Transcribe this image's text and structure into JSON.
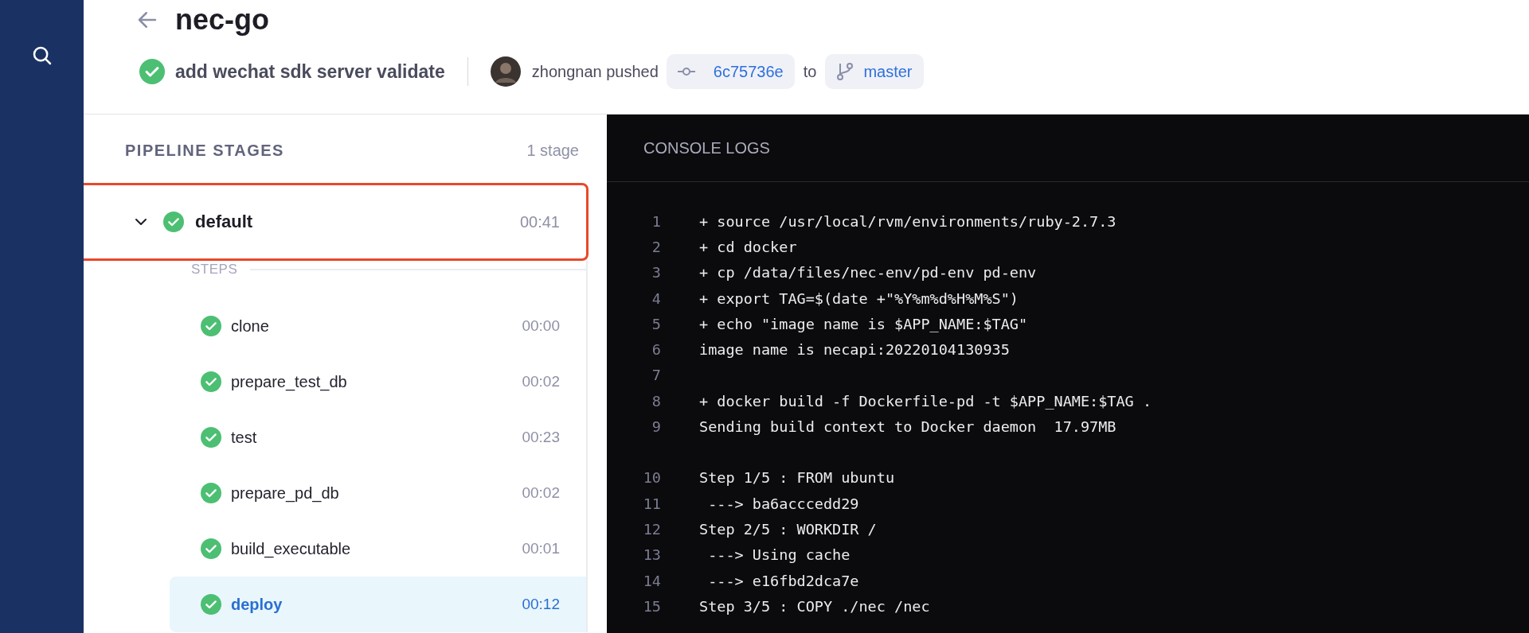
{
  "header": {
    "title": "nec-go",
    "commit": {
      "kind": "success",
      "message": "add wechat sdk server validate",
      "author": "zhongnan pushed",
      "sha": "6c75736e",
      "connector": "to",
      "branch": "master"
    }
  },
  "stages_panel": {
    "title": "PIPELINE STAGES",
    "count": "1 stage",
    "stages": [
      {
        "name": "default",
        "kind": "success",
        "duration": "00:41",
        "expanded": true,
        "highlighted": true,
        "steps_label": "STEPS",
        "steps": [
          {
            "name": "clone",
            "kind": "success",
            "duration": "00:00",
            "selected": false
          },
          {
            "name": "prepare_test_db",
            "kind": "success",
            "duration": "00:02",
            "selected": false
          },
          {
            "name": "test",
            "kind": "success",
            "duration": "00:23",
            "selected": false
          },
          {
            "name": "prepare_pd_db",
            "kind": "success",
            "duration": "00:02",
            "selected": false
          },
          {
            "name": "build_executable",
            "kind": "success",
            "duration": "00:01",
            "selected": false
          },
          {
            "name": "deploy",
            "kind": "success",
            "duration": "00:12",
            "selected": true
          }
        ]
      }
    ]
  },
  "console": {
    "title": "CONSOLE LOGS",
    "groups": [
      {
        "lines": [
          {
            "number": "1",
            "text": "+ source /usr/local/rvm/environments/ruby-2.7.3"
          },
          {
            "number": "2",
            "text": "+ cd docker"
          },
          {
            "number": "3",
            "text": "+ cp /data/files/nec-env/pd-env pd-env"
          },
          {
            "number": "4",
            "text": "+ export TAG=$(date +\"%Y%m%d%H%M%S\")"
          },
          {
            "number": "5",
            "text": "+ echo \"image name is $APP_NAME:$TAG\""
          },
          {
            "number": "6",
            "text": "image name is necapi:20220104130935"
          },
          {
            "number": "7"
          },
          {
            "number": "8",
            "text": "+ docker build -f Dockerfile-pd -t $APP_NAME:$TAG ."
          },
          {
            "number": "9",
            "text": "Sending build context to Docker daemon  17.97MB"
          }
        ]
      },
      {
        "lines": [
          {
            "number": "10",
            "text": "Step 1/5 : FROM ubuntu"
          },
          {
            "number": "11",
            "text": " ---> ba6acccedd29"
          },
          {
            "number": "12",
            "text": "Step 2/5 : WORKDIR /"
          },
          {
            "number": "13",
            "text": " ---> Using cache"
          },
          {
            "number": "14",
            "text": " ---> e16fbd2dca7e"
          },
          {
            "number": "15",
            "text": "Step 3/5 : COPY ./nec /nec"
          }
        ]
      }
    ]
  }
}
